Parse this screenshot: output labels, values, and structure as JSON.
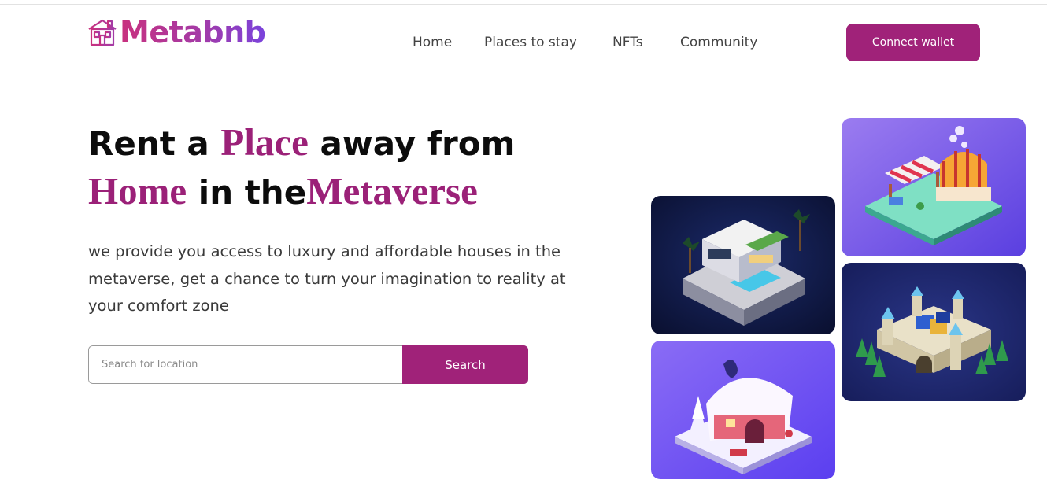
{
  "header": {
    "logo_text": "Metabnb",
    "nav": [
      {
        "label": "Home"
      },
      {
        "label": "Places to stay"
      },
      {
        "label": "NFTs"
      },
      {
        "label": "Community"
      }
    ],
    "connect_label": "Connect wallet"
  },
  "hero": {
    "headline": {
      "w1": "Rent a ",
      "w2": "Place",
      "w3": " away from",
      "w4": "Home",
      "w5": " in the",
      "w6": "Metaverse"
    },
    "description": "we provide you access to luxury and affordable houses in the metaverse, get a chance to turn your imagination to reality at your comfort zone",
    "search": {
      "placeholder": "Search for location",
      "value": "",
      "button_label": "Search"
    }
  },
  "gallery": {
    "cards": [
      {
        "icon": "modern-villa-pool-image"
      },
      {
        "icon": "market-stalls-image"
      },
      {
        "icon": "snowy-cottage-image"
      },
      {
        "icon": "castle-forest-image"
      }
    ]
  },
  "colors": {
    "accent": "#a02279",
    "heading_serif": "#9b2178",
    "logo_gradient_start": "#c9317e",
    "logo_gradient_end": "#7a43dc"
  }
}
